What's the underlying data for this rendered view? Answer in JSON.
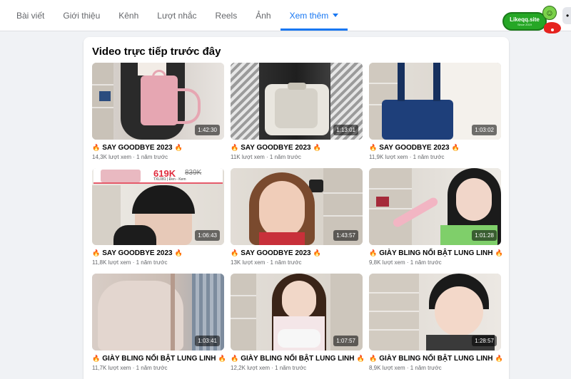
{
  "tabs": [
    {
      "label": "Bài viết"
    },
    {
      "label": "Giới thiệu"
    },
    {
      "label": "Kênh"
    },
    {
      "label": "Lượt nhắc"
    },
    {
      "label": "Reels"
    },
    {
      "label": "Ảnh"
    },
    {
      "label": "Xem thêm",
      "active": true
    }
  ],
  "brand": {
    "name": "Likeqq.site",
    "sub": "Since 2019"
  },
  "more_button": {
    "label": "•"
  },
  "section": {
    "title": "Video trực tiếp trước đây"
  },
  "price_overlay": {
    "new_price": "619K",
    "old_price": "839K",
    "code": "TXL081 | Đen - Kem"
  },
  "videos": [
    {
      "title": "SAY GOODBYE 2023",
      "meta": "14,3K lượt xem · 1 năm trước",
      "duration": "1:42:30"
    },
    {
      "title": "SAY GOODBYE 2023",
      "meta": "11K lượt xem · 1 năm trước",
      "duration": "1:13:01"
    },
    {
      "title": "SAY GOODBYE 2023",
      "meta": "11,9K lượt xem · 1 năm trước",
      "duration": "1:03:02"
    },
    {
      "title": "SAY GOODBYE 2023",
      "meta": "11,8K lượt xem · 1 năm trước",
      "duration": "1:06:43"
    },
    {
      "title": "SAY GOODBYE 2023",
      "meta": "13K lượt xem · 1 năm trước",
      "duration": "1:43:57"
    },
    {
      "title": "GIÀY BLING NỔI BẬT LUNG LINH",
      "meta": "9,8K lượt xem · 1 năm trước",
      "duration": "1:01:28"
    },
    {
      "title": "GIÀY BLING NỔI BẬT LUNG LINH",
      "meta": "11,7K lượt xem · 1 năm trước",
      "duration": "1:03:41"
    },
    {
      "title": "GIÀY BLING NỔI BẬT LUNG LINH",
      "meta": "12,2K lượt xem · 1 năm trước",
      "duration": "1:07:57"
    },
    {
      "title": "GIÀY BLING NỔI BẬT LUNG LINH",
      "meta": "8,9K lượt xem · 1 năm trước",
      "duration": "1:28:57"
    }
  ],
  "colors": {
    "accent": "#1877f2",
    "brand_green": "#26a726",
    "price_red": "#e02b3d"
  }
}
